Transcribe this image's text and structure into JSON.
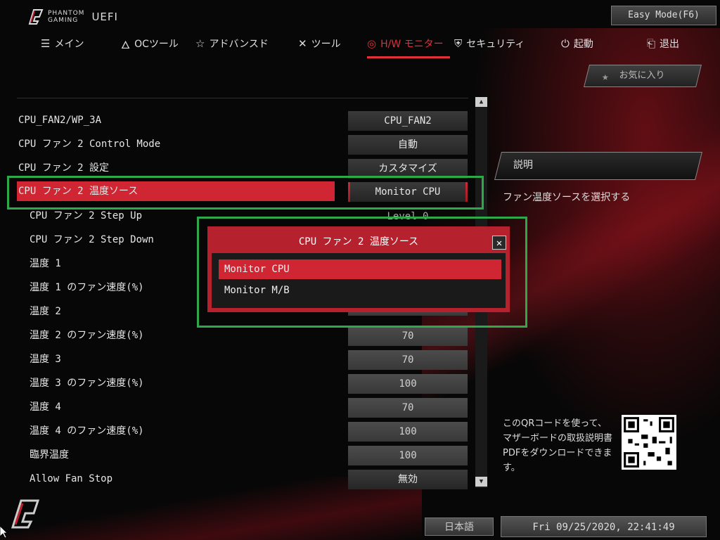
{
  "header": {
    "brand_line1": "PHANTOM",
    "brand_line2": "GAMING",
    "brand_suffix": "UEFI",
    "easy_mode_label": "Easy Mode(F6)"
  },
  "nav": {
    "items": [
      {
        "label": "メイン",
        "icon": "list-icon"
      },
      {
        "label": "OCツール",
        "icon": "rocket-icon"
      },
      {
        "label": "アドバンスド",
        "icon": "star-icon"
      },
      {
        "label": "ツール",
        "icon": "tools-icon"
      },
      {
        "label": "H/W モニター",
        "icon": "monitor-icon",
        "active": true
      },
      {
        "label": "セキュリティ",
        "icon": "shield-icon"
      },
      {
        "label": "起動",
        "icon": "power-icon"
      },
      {
        "label": "退出",
        "icon": "exit-icon"
      }
    ],
    "favorites_label": "お気に入り"
  },
  "settings": {
    "rows": [
      {
        "label": "CPU_FAN2/WP_3A",
        "value": "CPU_FAN2"
      },
      {
        "label": "CPU ファン 2 Control Mode",
        "value": "自動"
      },
      {
        "label": "CPU ファン 2 設定",
        "value": "カスタマイズ"
      },
      {
        "label": "CPU ファン 2 温度ソース",
        "value": "Monitor CPU",
        "selected": true
      },
      {
        "label": "CPU ファン 2 Step Up",
        "value": "Level 0"
      },
      {
        "label": "CPU ファン 2 Step Down",
        "value": ""
      },
      {
        "label": "温度 1",
        "value": ""
      },
      {
        "label": "温度 1 のファン速度(%)",
        "value": ""
      },
      {
        "label": "温度 2",
        "value": ""
      },
      {
        "label": "温度 2 のファン速度(%)",
        "value": "70"
      },
      {
        "label": "温度 3",
        "value": "70"
      },
      {
        "label": "温度 3 のファン速度(%)",
        "value": "100"
      },
      {
        "label": "温度 4",
        "value": "70"
      },
      {
        "label": "温度 4 のファン速度(%)",
        "value": "100"
      },
      {
        "label": "臨界温度",
        "value": "100"
      },
      {
        "label": "Allow Fan Stop",
        "value": "無効"
      }
    ]
  },
  "popup": {
    "title": "CPU ファン 2 温度ソース",
    "close_icon": "close-icon",
    "options": [
      "Monitor CPU",
      "Monitor M/B"
    ],
    "selected_option": "Monitor CPU"
  },
  "description": {
    "header": "説明",
    "text": "ファン温度ソースを選択する"
  },
  "qr": {
    "text": "このQRコードを使って、マザーボードの取扱説明書PDFをダウンロードできます。"
  },
  "footer": {
    "language": "日本語",
    "datetime": "Fri 09/25/2020, 22:41:49"
  },
  "colors": {
    "accent": "#d02634",
    "highlight_box": "#2fa84a"
  }
}
